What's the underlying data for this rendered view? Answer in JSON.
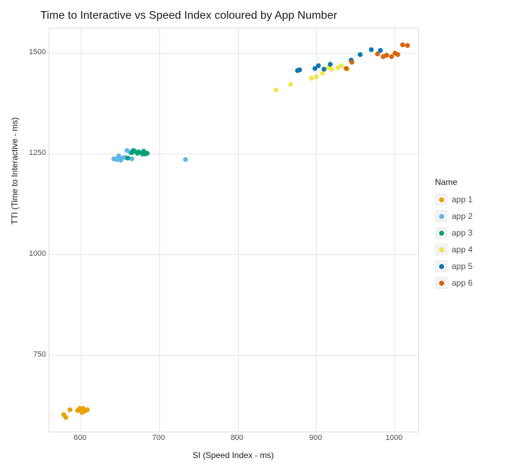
{
  "chart_data": {
    "type": "scatter",
    "title": "Time to Interactive vs Speed Index coloured by App Number",
    "xlabel": "SI (Speed Index - ms)",
    "ylabel": "TTI (Time to Interactive - ms)",
    "xlim": [
      560,
      1030
    ],
    "ylim": [
      560,
      1560
    ],
    "x_ticks": [
      600,
      700,
      800,
      900,
      1000
    ],
    "y_ticks": [
      750,
      1000,
      1250,
      1500
    ],
    "legend_title": "Name",
    "series": [
      {
        "name": "app 1",
        "color": "#e69f00",
        "points": [
          [
            578,
            603
          ],
          [
            581,
            595
          ],
          [
            586,
            614
          ],
          [
            596,
            613
          ],
          [
            599,
            617
          ],
          [
            601,
            608
          ],
          [
            603,
            614
          ],
          [
            603,
            618
          ],
          [
            605,
            611
          ],
          [
            608,
            614
          ]
        ]
      },
      {
        "name": "app 2",
        "color": "#56b4e9",
        "points": [
          [
            642,
            1237
          ],
          [
            646,
            1235
          ],
          [
            648,
            1244
          ],
          [
            651,
            1233
          ],
          [
            652,
            1239
          ],
          [
            656,
            1241
          ],
          [
            659,
            1258
          ],
          [
            663,
            1252
          ],
          [
            665,
            1237
          ],
          [
            733,
            1235
          ]
        ]
      },
      {
        "name": "app 3",
        "color": "#009e73",
        "points": [
          [
            660,
            1238
          ],
          [
            665,
            1252
          ],
          [
            667,
            1258
          ],
          [
            669,
            1255
          ],
          [
            672,
            1251
          ],
          [
            674,
            1254
          ],
          [
            678,
            1249
          ],
          [
            680,
            1255
          ],
          [
            682,
            1248
          ],
          [
            685,
            1251
          ]
        ]
      },
      {
        "name": "app 4",
        "color": "#f0e442",
        "points": [
          [
            849,
            1408
          ],
          [
            867,
            1421
          ],
          [
            894,
            1436
          ],
          [
            900,
            1440
          ],
          [
            908,
            1449
          ],
          [
            915,
            1463
          ],
          [
            920,
            1460
          ],
          [
            928,
            1462
          ],
          [
            932,
            1467
          ],
          [
            940,
            1459
          ]
        ]
      },
      {
        "name": "app 5",
        "color": "#0072b2",
        "points": [
          [
            876,
            1455
          ],
          [
            879,
            1458
          ],
          [
            898,
            1461
          ],
          [
            903,
            1468
          ],
          [
            910,
            1460
          ],
          [
            918,
            1471
          ],
          [
            944,
            1482
          ],
          [
            956,
            1495
          ],
          [
            970,
            1508
          ],
          [
            982,
            1505
          ]
        ]
      },
      {
        "name": "app 6",
        "color": "#d55e00",
        "points": [
          [
            938,
            1461
          ],
          [
            945,
            1477
          ],
          [
            978,
            1497
          ],
          [
            985,
            1490
          ],
          [
            990,
            1493
          ],
          [
            996,
            1491
          ],
          [
            1000,
            1498
          ],
          [
            1004,
            1495
          ],
          [
            1010,
            1520
          ],
          [
            1016,
            1518
          ]
        ]
      }
    ]
  }
}
